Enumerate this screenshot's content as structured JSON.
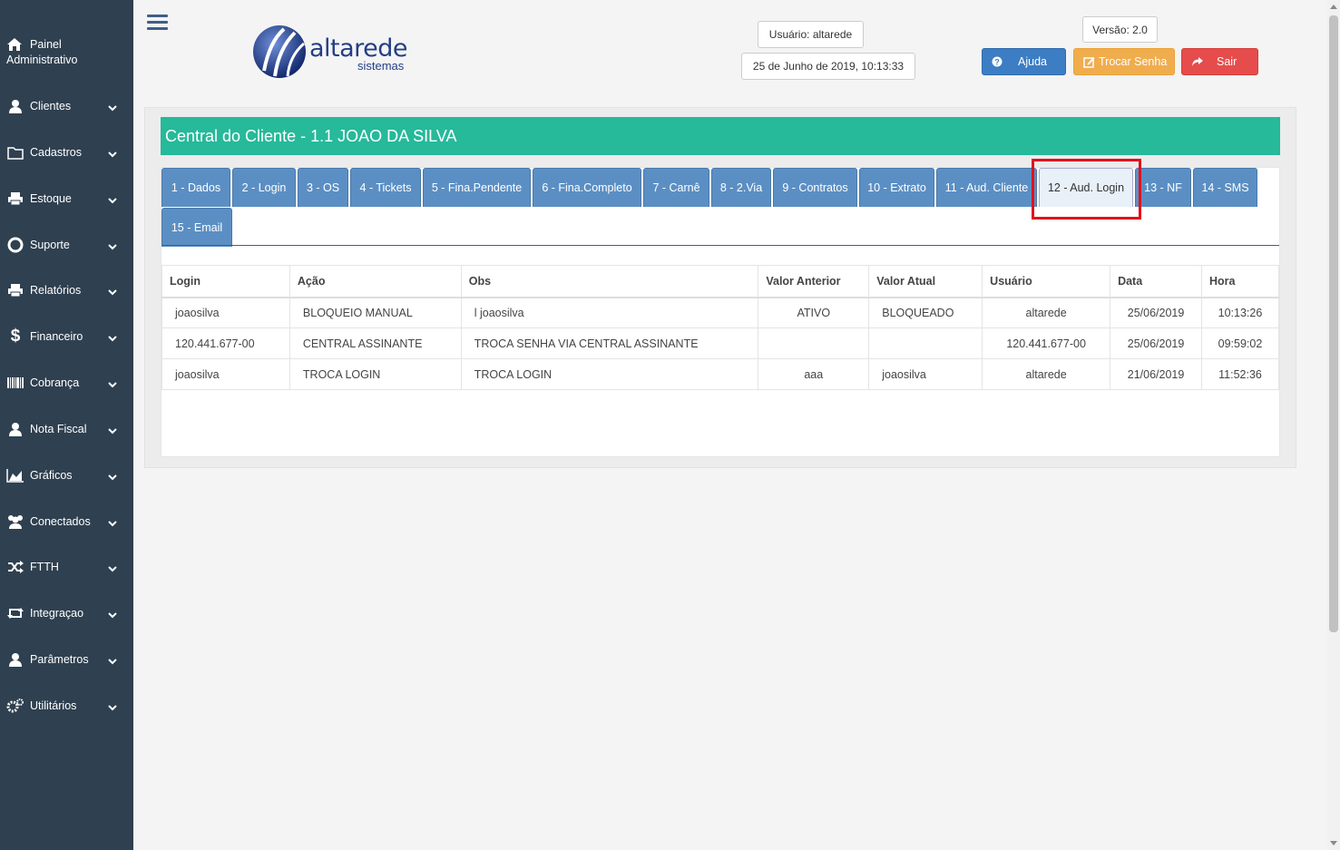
{
  "sidebar": {
    "home": {
      "line1": "Painel",
      "line2": "Administrativo",
      "icon": "home-icon"
    },
    "items": [
      {
        "label": "Clientes",
        "icon": "user-icon"
      },
      {
        "label": "Cadastros",
        "icon": "folder-icon"
      },
      {
        "label": "Estoque",
        "icon": "print-icon"
      },
      {
        "label": "Suporte",
        "icon": "lifebuoy-icon"
      },
      {
        "label": "Relatórios",
        "icon": "print-icon"
      },
      {
        "label": "Financeiro",
        "icon": "dollar-icon"
      },
      {
        "label": "Cobrança",
        "icon": "barcode-icon"
      },
      {
        "label": "Nota Fiscal",
        "icon": "user-icon"
      },
      {
        "label": "Gráficos",
        "icon": "area-chart-icon"
      },
      {
        "label": "Conectados",
        "icon": "users-icon"
      },
      {
        "label": "FTTH",
        "icon": "shuffle-icon"
      },
      {
        "label": "Integraçao",
        "icon": "retweet-icon"
      },
      {
        "label": "Parâmetros",
        "icon": "user-icon"
      },
      {
        "label": "Utilitários",
        "icon": "gears-icon"
      }
    ]
  },
  "header": {
    "logo_word": "altarede",
    "logo_sub": "sistemas",
    "user": "Usuário: altarede",
    "datetime": "25 de Junho de 2019, 10:13:33",
    "version": "Versão: 2.0",
    "btn_help": "Ajuda",
    "btn_change_password": "Trocar Senha",
    "btn_exit": "Sair"
  },
  "colors": {
    "sidebar": "#2f4050",
    "banner": "#26b99a",
    "tab": "#5b8fc4",
    "help": "#3c7dc4",
    "warning": "#f0ad4e",
    "danger": "#e64c4c",
    "highlight": "#e3101c"
  },
  "banner": {
    "title": "Central do Cliente - 1.1 JOAO DA SILVA"
  },
  "tabs": [
    "1 - Dados",
    "2 - Login",
    "3 - OS",
    "4 - Tickets",
    "5 - Fina.Pendente",
    "6 - Fina.Completo",
    "7 - Carnê",
    "8 - 2.Via",
    "9 - Contratos",
    "10 - Extrato",
    "11 - Aud. Cliente",
    "12 - Aud. Login",
    "13 - NF",
    "14 - SMS",
    "15 - Email"
  ],
  "active_tab": "12 - Aud. Login",
  "table": {
    "headers": [
      "Login",
      "Ação",
      "Obs",
      "Valor Anterior",
      "Valor Atual",
      "Usuário",
      "Data",
      "Hora"
    ],
    "rows": [
      [
        "joaosilva",
        "BLOQUEIO MANUAL",
        "l joaosilva",
        "ATIVO",
        "BLOQUEADO",
        "altarede",
        "25/06/2019",
        "10:13:26"
      ],
      [
        "120.441.677-00",
        "CENTRAL ASSINANTE",
        "TROCA SENHA VIA CENTRAL ASSINANTE",
        "",
        "",
        "120.441.677-00",
        "25/06/2019",
        "09:59:02"
      ],
      [
        "joaosilva",
        "TROCA LOGIN",
        "TROCA LOGIN",
        "aaa",
        "joaosilva",
        "altarede",
        "21/06/2019",
        "11:52:36"
      ]
    ]
  }
}
